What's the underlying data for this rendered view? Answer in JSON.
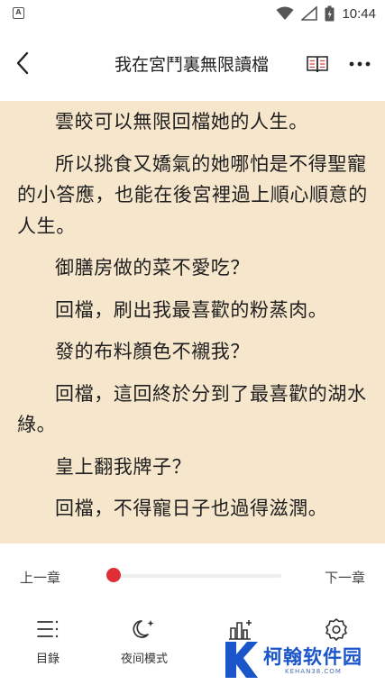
{
  "status_bar": {
    "time": "10:44",
    "app_badge_letter": "A",
    "icons": [
      "wifi-icon",
      "signal-icon",
      "battery-icon"
    ]
  },
  "header": {
    "title": "我在宮鬥裏無限讀檔",
    "back_icon": "chevron-left-icon",
    "book_icon": "book-icon",
    "more_icon": "more-dots-icon"
  },
  "content": {
    "background": "#f6e6cc",
    "paragraphs": [
      "雲皎可以無限回檔她的人生。",
      "所以挑食又嬌氣的她哪怕是不得聖寵的小答應，也能在後宮裡過上順心順意的人生。",
      "御膳房做的菜不愛吃？",
      "回檔，刷出我最喜歡的粉蒸肉。",
      "發的布料顏色不襯我？",
      "回檔，這回終於分到了最喜歡的湖水綠。",
      "皇上翻我牌子？",
      "回檔，不得寵日子也過得滋潤。"
    ]
  },
  "progress": {
    "prev_label": "上一章",
    "next_label": "下一章",
    "value": 0.03,
    "accent": "#e02e36"
  },
  "toolbar": {
    "items": [
      {
        "label": "目錄",
        "icon": "menu-list-icon"
      },
      {
        "label": "夜间模式",
        "icon": "moon-icon"
      },
      {
        "label": "",
        "icon": "brightness-icon"
      },
      {
        "label": "",
        "icon": "settings-icon"
      }
    ]
  },
  "watermark": {
    "text": "柯翰软件园",
    "sub": "KEHAN38.COM",
    "color": "#1a56c9"
  }
}
